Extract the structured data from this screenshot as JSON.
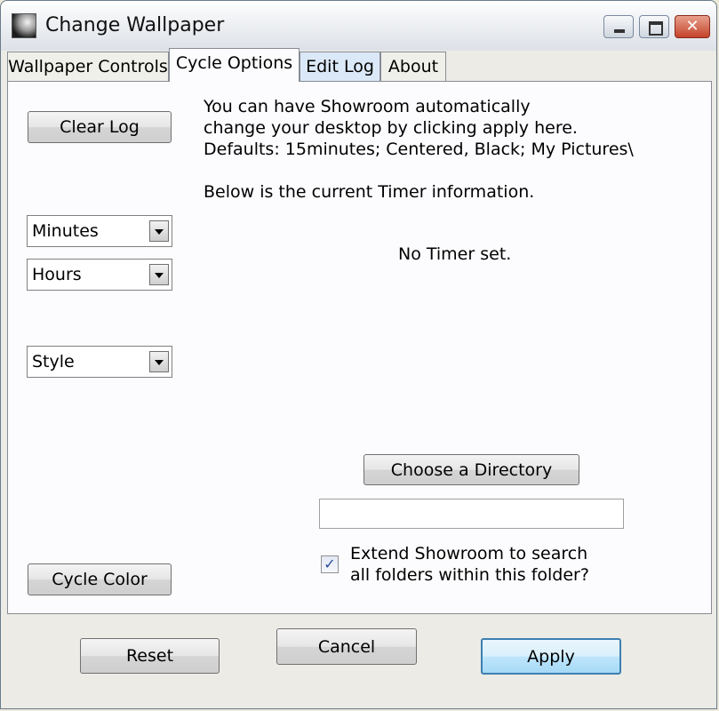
{
  "window": {
    "title": "Change Wallpaper"
  },
  "tabs": [
    {
      "label": "Wallpaper Controls"
    },
    {
      "label": "Cycle Options"
    },
    {
      "label": "Edit Log"
    },
    {
      "label": "About"
    }
  ],
  "left": {
    "clear_log": "Clear Log",
    "minutes": "Minutes",
    "hours": "Hours",
    "style": "Style",
    "cycle_color": "Cycle Color"
  },
  "info": {
    "line1": "You can have Showroom automatically",
    "line2": "change your desktop by clicking apply here.",
    "line3": "Defaults: 15minutes; Centered, Black; My Pictures\\",
    "timer_intro": "Below is the current Timer information.",
    "timer_status": "No Timer set."
  },
  "directory": {
    "button": "Choose a Directory",
    "value": "",
    "extend_line1": "Extend Showroom to search",
    "extend_line2": "all folders within this folder?",
    "extend_checked": "✓"
  },
  "footer": {
    "reset": "Reset",
    "cancel": "Cancel",
    "apply": "Apply"
  }
}
